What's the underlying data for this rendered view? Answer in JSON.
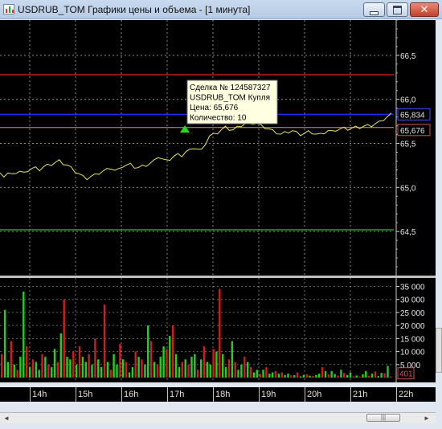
{
  "window": {
    "title": "USDRUB_TOM Графики цены и объема - [1 минута]",
    "buttons": [
      "minimize",
      "maximize",
      "close"
    ]
  },
  "colors": {
    "price_line": "#e8e868",
    "resistance_line": "#c81a1a",
    "bid_line": "#1a2cff",
    "trade_line": "#d2956a",
    "support_line": "#2fa02f",
    "volume_up": "#22d022",
    "volume_down": "#d21d1d",
    "grid": "#c8c8c8"
  },
  "price_axis": {
    "ticks": [
      "66,5",
      "66,0",
      "65,5",
      "65,0",
      "64,5"
    ]
  },
  "price_markers": {
    "current": "65,834",
    "trade": "65,676"
  },
  "tooltip": {
    "lines": [
      "Сделка № 124587327",
      "USDRUB_TOM Купля",
      "Цена: 65,676",
      "Количество: 10"
    ]
  },
  "volume_axis": {
    "ticks": [
      "35 000",
      "30 000",
      "25 000",
      "20 000",
      "15 000",
      "10 000",
      "5 000"
    ],
    "current": "401"
  },
  "time_axis": {
    "labels": [
      "14h",
      "15h",
      "16h",
      "17h",
      "18h",
      "19h",
      "20h",
      "21h",
      "22h"
    ]
  },
  "scrollbar": {
    "left_arrow": "◄",
    "right_arrow": "►",
    "thumb_grip": "|||"
  },
  "chart_data": [
    {
      "type": "line",
      "title": "",
      "xlabel": "",
      "ylabel": "",
      "x_range": [
        "13:20",
        "22:00"
      ],
      "ylim": [
        64.0,
        66.9
      ],
      "horizontal_levels": [
        66.28,
        65.83,
        65.68,
        64.52
      ],
      "series": [
        {
          "values": [
            65.15,
            65.13,
            65.16,
            65.14,
            65.17,
            65.18,
            65.16,
            65.19,
            65.21,
            65.22,
            65.2,
            65.23,
            65.25,
            65.26,
            65.28,
            65.3,
            65.27,
            65.25,
            65.22,
            65.18,
            65.15,
            65.12,
            65.1,
            65.12,
            65.14,
            65.16,
            65.18,
            65.2,
            65.22,
            65.19,
            65.2,
            65.24,
            65.25,
            65.26,
            65.23,
            65.22,
            65.24,
            65.25,
            65.27,
            65.3,
            65.35,
            65.32,
            65.3,
            65.32,
            65.35,
            65.37,
            65.36,
            65.4,
            65.42,
            65.45,
            65.43,
            65.42,
            65.5,
            65.58,
            65.6,
            65.62,
            65.65,
            65.68,
            65.66,
            65.65,
            65.68,
            65.7,
            65.72,
            65.71,
            65.73,
            65.72,
            65.7,
            65.68,
            65.66,
            65.64,
            65.62,
            65.6,
            65.62,
            65.63,
            65.64,
            65.62,
            65.6,
            65.61,
            65.63,
            65.62,
            65.6,
            65.6,
            65.62,
            65.64,
            65.63,
            65.65,
            65.66,
            65.67,
            65.66,
            65.67,
            65.68,
            65.68,
            65.69,
            65.7,
            65.7,
            65.72,
            65.74,
            65.77,
            65.8,
            65.83
          ]
        }
      ]
    },
    {
      "type": "bar",
      "title": "",
      "xlabel": "",
      "ylabel": "",
      "x_range": [
        "13:20",
        "22:00"
      ],
      "ylim": [
        0,
        37000
      ],
      "series": [
        {
          "name_hidden": true,
          "values": [
            9000,
            26000,
            6000,
            14000,
            5000,
            3000,
            8000,
            33000,
            12000,
            4000,
            7000,
            6000,
            3000,
            9000,
            8000,
            5000,
            4000,
            11000,
            6000,
            17000,
            30000,
            8000,
            7000,
            10000,
            5000,
            12000,
            8000,
            6000,
            9000,
            5000,
            15000,
            7000,
            4000,
            28000,
            6000,
            3000,
            9000,
            5000,
            13000,
            7000,
            6000,
            2000,
            4000,
            10000,
            8000,
            7000,
            5000,
            20000,
            14000,
            6000,
            5000,
            8000,
            12000,
            11000,
            16000,
            20000,
            9000,
            4000,
            6000,
            7000,
            5000,
            8000,
            9000,
            3000,
            7000,
            12000,
            6000,
            5000,
            11000,
            10000,
            34000,
            9000,
            4000,
            7000,
            14000,
            6000,
            3000,
            5000,
            8000,
            6000,
            4000,
            2000,
            3000,
            1500,
            3000,
            4000,
            1500,
            2000,
            2500,
            1500,
            2000,
            1000,
            1500,
            800,
            900,
            2000,
            500,
            1000,
            1200,
            700,
            600,
            1000,
            1500,
            4000,
            2500,
            1200,
            2500,
            1400,
            700,
            3000,
            1800,
            1000,
            2000,
            500,
            800,
            400,
            1300,
            2500,
            700,
            1500,
            2300,
            600,
            1800,
            1700,
            4500,
            401
          ]
        }
      ]
    }
  ]
}
